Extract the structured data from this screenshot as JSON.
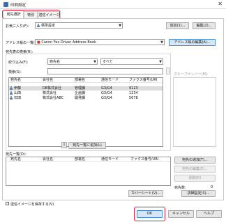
{
  "window": {
    "title": "印刷設定",
    "close_glyph": "✕"
  },
  "tabs": [
    {
      "label": "宛先選択",
      "active": true
    },
    {
      "label": "特別",
      "active": false
    },
    {
      "label": "送信イメージ",
      "active": false
    }
  ],
  "favorites": {
    "label": "お気に入り(F):",
    "value": "標準設定",
    "add_button": "追加(1)...",
    "edit_button": "編集(2)..."
  },
  "address_book": {
    "label": "アドレス帳の一覧(B):",
    "value": "Canon Fax Driver Address Book",
    "edit_button": "アドレス帳の編集(A)..."
  },
  "search": {
    "group_label": "宛先表の検索(R):",
    "filter_label": "絞り込み(F):",
    "filter_value": "宛先名",
    "filter_value2": "すべて",
    "keyword_label": "検索(S):",
    "keyword_value": ""
  },
  "group_members_label": "グループメンバー(M):",
  "contacts": {
    "columns": [
      "宛先名",
      "会社名",
      "部署名",
      "通信モード",
      "ファクス番号/URI"
    ],
    "rows": [
      {
        "name": "伊藤",
        "company": "DE株式会社",
        "dept": "管理課",
        "mode": "G3/G4",
        "fax": "9123",
        "selected": true
      },
      {
        "name": "山田",
        "company": "株式会社",
        "dept": "企画課",
        "mode": "G3/G4",
        "fax": "1234",
        "selected": false
      },
      {
        "name": "石田",
        "company": "株式会社ABC",
        "dept": "開発課",
        "mode": "G3/G4",
        "fax": "5678",
        "selected": false
      }
    ]
  },
  "add_to_list_button": "宛先一覧に追加(L)",
  "recipients": {
    "label": "宛先一覧(D):",
    "columns": [
      "宛先名",
      "会社名",
      "部署名",
      "通信モード",
      "ファクス番号/URI"
    ],
    "add_button": "宛先の追加(T)...",
    "edit_button": "宛先の編集(E)...",
    "delete_button": "削除(R)",
    "count_label": "宛先数:",
    "count_value": "0"
  },
  "cover_sheet_button": "カバーシート(V)...",
  "detail_button": "詳細設定(S)...",
  "save_image": {
    "label": "送信イメージを保存する(V)",
    "checked": false
  },
  "footer": {
    "ok": "OK",
    "cancel": "キャンセル",
    "help": "ヘルプ"
  },
  "colors": {
    "highlight": "#e0203a",
    "selection": "#dcdcdc",
    "accent": "#4a90d9"
  }
}
